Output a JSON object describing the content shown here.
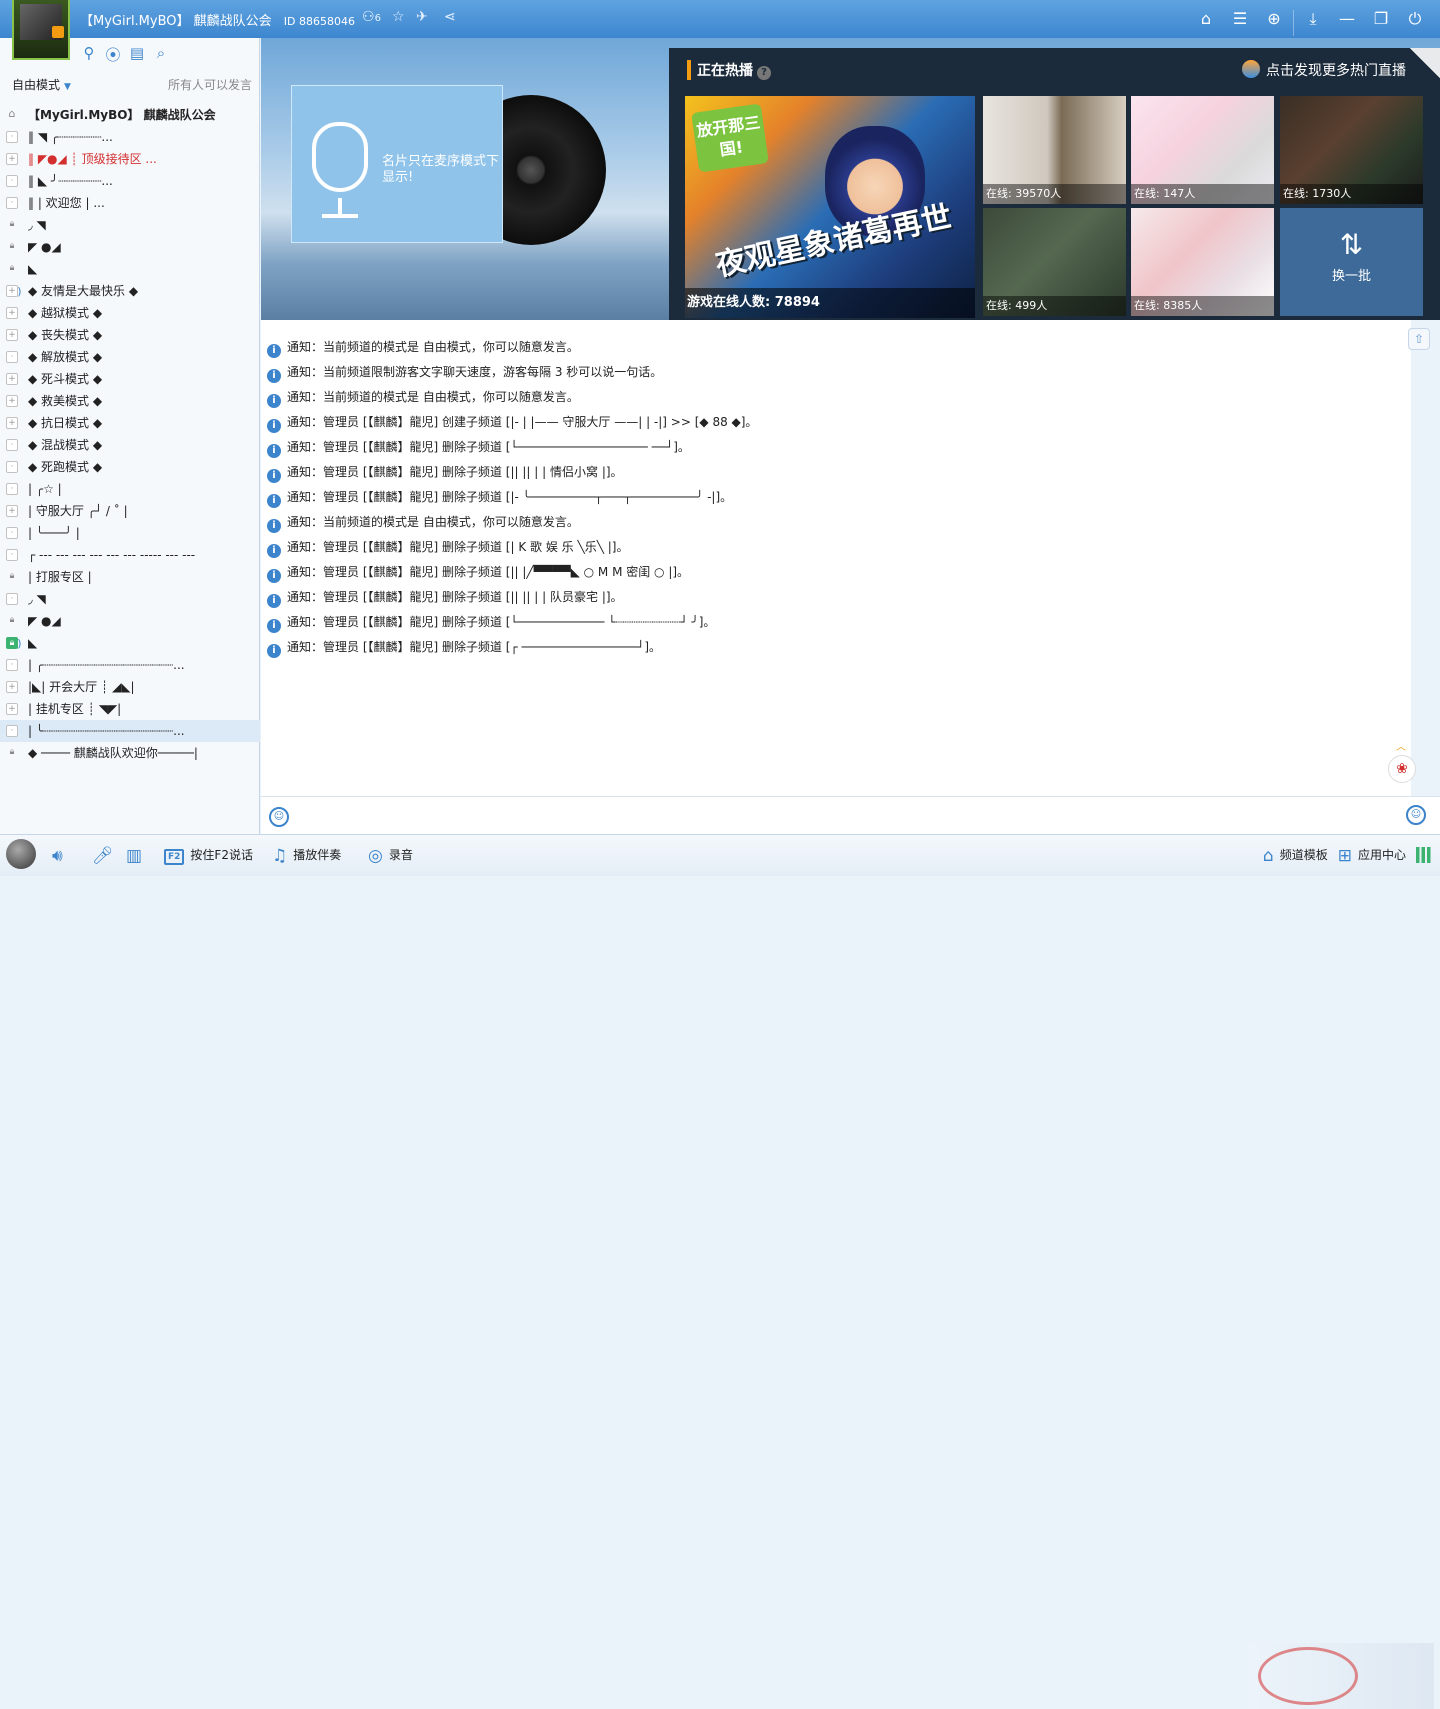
{
  "titlebar": {
    "channel_name": "【MyGirl.MyBO】 麒麟战队公会",
    "channel_id": "ID 88658046",
    "user_count": "6",
    "icons": [
      "users-icon",
      "star-icon",
      "plane-icon",
      "share-icon"
    ],
    "right_icons": [
      "home-icon",
      "list-icon",
      "gamepad-icon",
      "download-icon",
      "minimize-icon",
      "restore-icon",
      "power-icon"
    ]
  },
  "left": {
    "tools": [
      "user-add-icon",
      "location-icon",
      "document-icon",
      "search-icon"
    ],
    "mode": "自由模式",
    "mode_note": "所有人可以发言",
    "tree": [
      {
        "mk": "home",
        "text": "【MyGirl.MyBO】 麒麟战队公会",
        "bold": true
      },
      {
        "mk": "dot",
        "text": "‖        ◥          ╭┈┈┈┈┈┈..."
      },
      {
        "mk": "plus",
        "text": "‖   ◤●◢      ┊ 顶级接待区 ...",
        "red": true
      },
      {
        "mk": "dot",
        "text": "‖        ◣          ╯┈┈┈┈┈┈..."
      },
      {
        "mk": "dot",
        "text": "‖                      | 欢迎您 |    ..."
      },
      {
        "mk": "lock",
        "text": "              ◞   ◥"
      },
      {
        "mk": "lock",
        "text": "                  ◤ ●◢"
      },
      {
        "mk": "lock",
        "text": "                    ◣"
      },
      {
        "mk": "plus",
        "text": "◆          友情是大最快乐          ◆",
        "count": "(1)"
      },
      {
        "mk": "plus",
        "text": "◆          越狱模式                ◆"
      },
      {
        "mk": "plus",
        "text": "◆          丧失模式                ◆"
      },
      {
        "mk": "dot",
        "text": "◆          解放模式                ◆"
      },
      {
        "mk": "plus",
        "text": "◆          死斗模式                ◆"
      },
      {
        "mk": "plus",
        "text": "◆          救美模式                ◆"
      },
      {
        "mk": "plus",
        "text": "◆          抗日模式                ◆"
      },
      {
        "mk": "dot",
        "text": "◆          混战模式                ◆"
      },
      {
        "mk": "dot",
        "text": "◆          死跑模式                ◆"
      },
      {
        "mk": "dot",
        "text": "|                          ╭☆            |"
      },
      {
        "mk": "plus",
        "text": "|         守服大厅       ╭┘   / ˚         |"
      },
      {
        "mk": "dot",
        "text": "|                        ╰───╯           |"
      },
      {
        "mk": "dot",
        "text": "┌ --- --- --- --- --- --- ----- --- ---"
      },
      {
        "mk": "lock",
        "text": "|          打服专区                      |"
      },
      {
        "mk": "dot",
        "text": "              ◞   ◥"
      },
      {
        "mk": "lock",
        "text": "                  ◤ ●◢"
      },
      {
        "mk": "green",
        "text": "                    ◣",
        "count": "(1)"
      },
      {
        "mk": "dot",
        "text": "|       ╭┈┈┈┈┈┈┈┈┈┈┈┈┈┈┈┈┈┈..."
      },
      {
        "mk": "plus",
        "text": "|◣|   开会大厅      ┊ ◢◣|"
      },
      {
        "mk": "plus",
        "text": "|      挂机专区                  ┊ ◥◤|"
      },
      {
        "mk": "dot",
        "text": "|       ╰┈┈┈┈┈┈┈┈┈┈┈┈┈┈┈┈┈┈...",
        "highlight": true
      },
      {
        "mk": "lock",
        "text": "◆ ──── 麒麟战队欢迎你─────|"
      }
    ]
  },
  "banner": {
    "card_text": "名片只在麦序模式下显示!",
    "hot_title": "正在热播",
    "hot_more": "点击发现更多热门直播",
    "big": {
      "tag": "放开那三国!",
      "headline": "夜观星象诸葛再世",
      "online": "游戏在线人数: 78894"
    },
    "tiles": [
      {
        "online": "在线: 39570人"
      },
      {
        "online": "在线: 147人"
      },
      {
        "online": "在线: 1730人"
      },
      {
        "online": "在线: 499人"
      },
      {
        "online": "在线: 8385人"
      }
    ],
    "refresh": "换一批"
  },
  "messages": [
    "通知：当前频道的模式是 自由模式，你可以随意发言。",
    "通知：当前频道限制游客文字聊天速度，游客每隔 3 秒可以说一句话。",
    "通知：当前频道的模式是 自由模式，你可以随意发言。",
    "通知：管理员 [【麒麟】龍児] 创建子频道 [|-   |   |—— 守服大厅 ——|  |  -|] >> [◆    88    ◆]。",
    "通知：管理员 [【麒麟】龍児] 删除子频道 [└──────────────────        ──┘]。",
    "通知：管理员 [【麒麟】龍児] 删除子频道 [||  ||  |  |    情侣小窝       |]。",
    "通知：管理员 [【麒麟】龍児] 删除子频道 [|-   ╰─────────┬───┬─────────╯   -|]。",
    "通知：当前频道的模式是 自由模式，你可以随意发言。",
    "通知：管理员 [【麒麟】龍児] 删除子频道 [|   K 歌 娱 乐        ╲乐╲       |]。",
    "通知：管理员 [【麒麟】龍児] 删除子频道 [||  |╱▀▀▀▀◣  ○ M M 密闺 ○    |]。",
    "通知：管理员 [【麒麟】龍児] 删除子频道 [||  ||  |  |    队员豪宅       |]。",
    "通知：管理员 [【麒麟】龍児] 删除子频道 [└────────────   └┈┈┈┈┈┈┈┈┈┘ ╯]。",
    "通知：管理员 [【麒麟】龍児] 删除子频道 [┌                ────────────────┘]。"
  ],
  "bottom": {
    "buttons": [
      {
        "icon": "speaker-icon",
        "label": ""
      },
      {
        "icon": "microphone-icon",
        "label": ""
      },
      {
        "icon": "equalizer-icon",
        "label": ""
      },
      {
        "icon": "f2-key-icon",
        "label": "按住F2说话"
      },
      {
        "icon": "music-note-icon",
        "label": "播放伴奏"
      },
      {
        "icon": "record-icon",
        "label": "录音"
      }
    ],
    "channel_template": "频道模板",
    "app_center": "应用中心"
  }
}
